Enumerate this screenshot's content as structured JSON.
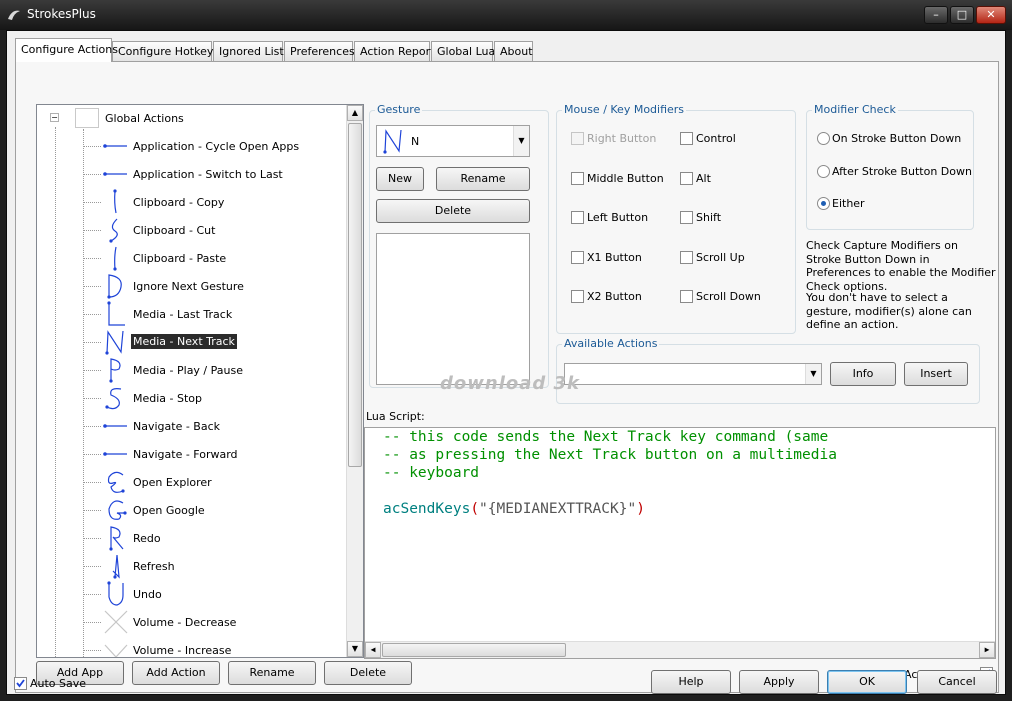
{
  "window": {
    "title": "StrokesPlus",
    "controls": {
      "minimize": "–",
      "maximize": "□",
      "close": "✕"
    }
  },
  "tabs": [
    {
      "label": "Configure Actions",
      "active": true
    },
    {
      "label": "Configure Hotkeys"
    },
    {
      "label": "Ignored List"
    },
    {
      "label": "Preferences"
    },
    {
      "label": "Action Report"
    },
    {
      "label": "Global Lua"
    },
    {
      "label": "About"
    }
  ],
  "tree": {
    "root_label": "Global Actions",
    "items": [
      {
        "label": "Application - Cycle Open Apps",
        "icon": "gesture-line-icon"
      },
      {
        "label": "Application - Switch to Last",
        "icon": "gesture-line-icon"
      },
      {
        "label": "Clipboard - Copy",
        "icon": "gesture-copy-icon"
      },
      {
        "label": "Clipboard - Cut",
        "icon": "gesture-cut-icon"
      },
      {
        "label": "Clipboard - Paste",
        "icon": "gesture-paste-icon"
      },
      {
        "label": "Ignore Next Gesture",
        "icon": "gesture-d-icon"
      },
      {
        "label": "Media - Last Track",
        "icon": "gesture-l-icon"
      },
      {
        "label": "Media - Next Track",
        "icon": "gesture-n-icon",
        "selected": true
      },
      {
        "label": "Media - Play / Pause",
        "icon": "gesture-p-icon"
      },
      {
        "label": "Media - Stop",
        "icon": "gesture-s-icon"
      },
      {
        "label": "Navigate - Back",
        "icon": "gesture-line-icon"
      },
      {
        "label": "Navigate - Forward",
        "icon": "gesture-line-icon"
      },
      {
        "label": "Open Explorer",
        "icon": "gesture-e-icon"
      },
      {
        "label": "Open Google",
        "icon": "gesture-g-icon"
      },
      {
        "label": "Redo",
        "icon": "gesture-r-icon"
      },
      {
        "label": "Refresh",
        "icon": "gesture-refresh-icon"
      },
      {
        "label": "Undo",
        "icon": "gesture-u-icon"
      },
      {
        "label": "Volume - Decrease",
        "icon": "gesture-x-icon"
      },
      {
        "label": "Volume - Increase",
        "icon": "gesture-v-icon"
      }
    ],
    "buttons": {
      "add_app": "Add App",
      "add_action": "Add Action",
      "rename": "Rename",
      "delete": "Delete"
    }
  },
  "gesture": {
    "title": "Gesture",
    "selected": "N",
    "new": "New",
    "rename": "Rename",
    "delete": "Delete"
  },
  "modifiers": {
    "title": "Mouse / Key Modifiers",
    "col1": [
      {
        "label": "Right Button",
        "disabled": true
      },
      {
        "label": "Middle Button"
      },
      {
        "label": "Left Button"
      },
      {
        "label": "X1 Button"
      },
      {
        "label": "X2 Button"
      }
    ],
    "col2": [
      {
        "label": "Control"
      },
      {
        "label": "Alt"
      },
      {
        "label": "Shift"
      },
      {
        "label": "Scroll Up"
      },
      {
        "label": "Scroll Down"
      }
    ]
  },
  "modifier_check": {
    "title": "Modifier Check",
    "options": [
      {
        "label": "On Stroke Button Down"
      },
      {
        "label": "After Stroke Button Down"
      },
      {
        "label": "Either",
        "selected": true
      }
    ],
    "note1": "Check Capture Modifiers on Stroke Button Down in Preferences to enable the Modifier Check options.",
    "note2": "You don't have to select a gesture, modifier(s) alone can define an action."
  },
  "available_actions": {
    "title": "Available Actions",
    "value": "",
    "info": "Info",
    "insert": "Insert"
  },
  "lua": {
    "label": "Lua Script:",
    "comment1": "-- this code sends the Next Track key command (same",
    "comment2": "-- as pressing the Next Track button on a multimedia",
    "comment3": "-- keyboard",
    "func": "acSendKeys",
    "open": "(",
    "arg": "\"{MEDIANEXTTRACK}\"",
    "close": ")"
  },
  "footer": {
    "action_active": "Action Active",
    "auto_save": "Auto Save",
    "help": "Help",
    "apply": "Apply",
    "ok": "OK",
    "cancel": "Cancel"
  },
  "watermark": "download 3k",
  "colors": {
    "comment": "#009000",
    "function": "#008080",
    "string": "#c00000",
    "group_title": "#1c5a96"
  }
}
